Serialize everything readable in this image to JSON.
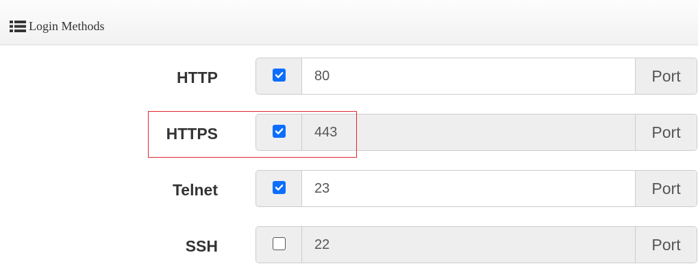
{
  "panel": {
    "title": "Login Methods",
    "icon": "list-icon"
  },
  "methods": [
    {
      "label": "HTTP",
      "enabled": true,
      "port": "80",
      "port_editable": true,
      "addon_label": "Port"
    },
    {
      "label": "HTTPS",
      "enabled": true,
      "port": "443",
      "port_editable": false,
      "addon_label": "Port"
    },
    {
      "label": "Telnet",
      "enabled": true,
      "port": "23",
      "port_editable": true,
      "addon_label": "Port"
    },
    {
      "label": "SSH",
      "enabled": false,
      "port": "22",
      "port_editable": false,
      "addon_label": "Port"
    }
  ],
  "colors": {
    "checkbox_checked": "#0d6efd",
    "highlight_border": "#e0242b",
    "addon_background": "#eeeeee",
    "label_text": "#333333"
  }
}
